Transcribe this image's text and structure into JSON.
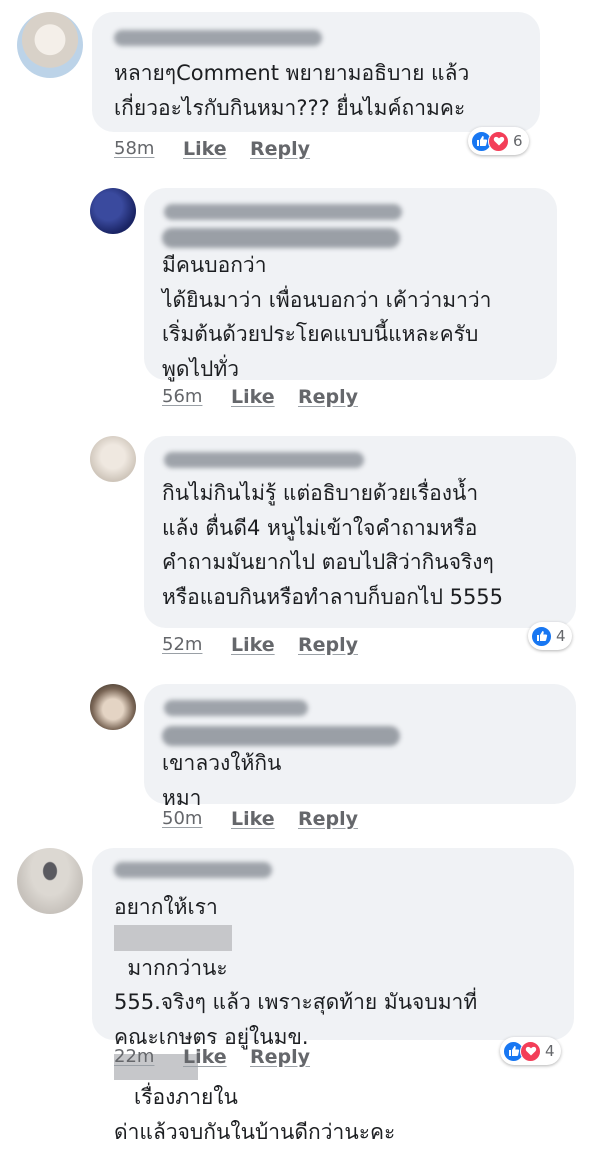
{
  "comments": [
    {
      "lines": [
        "หลายๆComment พยายามอธิบาย แล้ว",
        "เกี่ยวอะไรกับกินหมา??? ยื่นไมค์ถามคะ"
      ],
      "time": "58m",
      "like": "Like",
      "reply": "Reply",
      "reaction_count": "6",
      "reactions": [
        "like",
        "love"
      ],
      "avatar_color": "#e8e2da"
    },
    {
      "lines": [
        "มีคนบอกว่า",
        "ได้ยินมาว่า เพื่อนบอกว่า เค้าว่ามาว่า",
        "เริ่มต้นด้วยประโยคแบบนี้แหละครับ",
        "พูดไปทั่ว"
      ],
      "time": "56m",
      "like": "Like",
      "reply": "Reply",
      "avatar_color": "#23307a"
    },
    {
      "lines": [
        "กินไม่กินไม่รู้ แต่อธิบายด้วยเรื่องน้ำ",
        "แล้ง ตื่นดี4 หนูไม่เข้าใจคำถามหรือ",
        "คำถามมันยากไป ตอบไปสิว่ากินจริงๆ",
        "หรือแอบกินหรือทำลาบก็บอกไป 5555"
      ],
      "time": "52m",
      "like": "Like",
      "reply": "Reply",
      "reaction_count": "4",
      "reactions": [
        "like"
      ],
      "avatar_color": "#ddd5cc"
    },
    {
      "lines": [
        "เขาลวงให้กิน",
        "หมา"
      ],
      "time": "50m",
      "like": "Like",
      "reply": "Reply",
      "avatar_color": "#8a7b6c"
    },
    {
      "lines": [
        "อยากให้เรา",
        "มากกว่านะ",
        "555.จริงๆ แล้ว เพราะสุดท้าย มันจบมาที่",
        "คณะเกษตร อยู่ในมข.",
        "เรื่องภายใน",
        "ด่าแล้วจบกันในบ้านดีกว่านะคะ"
      ],
      "time": "22m",
      "like": "Like",
      "reply": "Reply",
      "reaction_count": "4",
      "reactions": [
        "like",
        "love"
      ],
      "avatar_color": "#c9c6c1"
    }
  ]
}
